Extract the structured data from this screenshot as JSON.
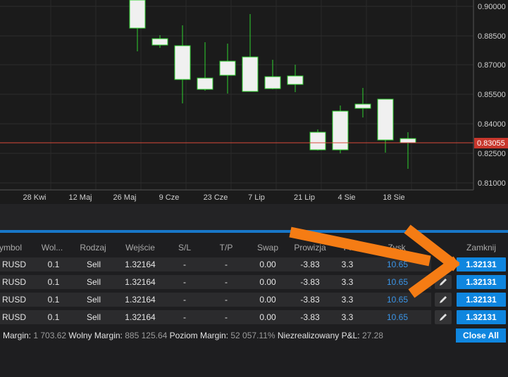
{
  "chart": {
    "price_axis": [
      "0.90000",
      "0.88500",
      "0.87000",
      "0.85500",
      "0.84000",
      "0.82500",
      "0.81000"
    ],
    "current_price": "0.83055",
    "date_axis": [
      "28 Kwi",
      "12 Maj",
      "26 Maj",
      "9 Cze",
      "23 Cze",
      "7 Lip",
      "21 Lip",
      "4 Sie",
      "18 Sie"
    ],
    "colors": {
      "candle_wick": "#2fd12f",
      "candle_body": "#f0f0f0",
      "price_line": "#d94a3a",
      "price_badge": "#c8372c"
    }
  },
  "positions": {
    "columns": [
      "ymbol",
      "Wol...",
      "Rodzaj",
      "Wejście",
      "S/L",
      "T/P",
      "Swap",
      "Prowizja",
      "Pi",
      "Zysk",
      "Zamknij"
    ],
    "rows": [
      {
        "symbol": "RUSD",
        "volume": "0.1",
        "type": "Sell",
        "entry": "1.32164",
        "sl": "-",
        "tp": "-",
        "swap": "0.00",
        "commission": "-3.83",
        "pips": "3.3",
        "profit": "10.65",
        "close": "1.32131"
      },
      {
        "symbol": "RUSD",
        "volume": "0.1",
        "type": "Sell",
        "entry": "1.32164",
        "sl": "-",
        "tp": "-",
        "swap": "0.00",
        "commission": "-3.83",
        "pips": "3.3",
        "profit": "10.65",
        "close": "1.32131"
      },
      {
        "symbol": "RUSD",
        "volume": "0.1",
        "type": "Sell",
        "entry": "1.32164",
        "sl": "-",
        "tp": "-",
        "swap": "0.00",
        "commission": "-3.83",
        "pips": "3.3",
        "profit": "10.65",
        "close": "1.32131"
      },
      {
        "symbol": "RUSD",
        "volume": "0.1",
        "type": "Sell",
        "entry": "1.32164",
        "sl": "-",
        "tp": "-",
        "swap": "0.00",
        "commission": "-3.83",
        "pips": "3.3",
        "profit": "10.65",
        "close": "1.32131"
      }
    ]
  },
  "summary": {
    "margin_label": "Margin:",
    "margin_value": "1 703.62",
    "free_margin_label": "Wolny Margin:",
    "free_margin_value": "885 125.64",
    "margin_level_label": "Poziom Margin:",
    "margin_level_value": "52 057.11%",
    "unrealized_label": "Niezrealizowany P&L:",
    "unrealized_value": "27.28"
  },
  "close_all_label": "Close All",
  "annotation_color": "#f57c14"
}
